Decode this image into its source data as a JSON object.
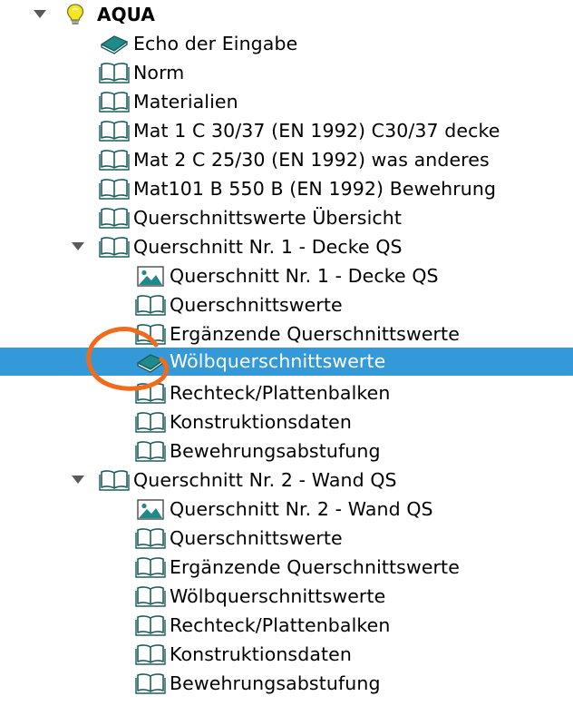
{
  "tree": {
    "root": {
      "label": "AQUA",
      "icon": "lightbulb-icon",
      "expanded": true
    },
    "items": [
      {
        "label": "Echo der Eingabe",
        "icon": "book-closed-icon"
      },
      {
        "label": "Norm",
        "icon": "book-open-icon"
      },
      {
        "label": "Materialien",
        "icon": "book-open-icon"
      },
      {
        "label": "Mat 1 C 30/37 (EN 1992) C30/37 decke",
        "icon": "book-open-icon"
      },
      {
        "label": "Mat 2 C 25/30 (EN 1992) was anderes",
        "icon": "book-open-icon"
      },
      {
        "label": "Mat101 B 550 B (EN 1992) Bewehrung",
        "icon": "book-open-icon"
      },
      {
        "label": "Querschnittswerte Übersicht",
        "icon": "book-open-icon"
      },
      {
        "label": "Querschnitt Nr. 1 - Decke QS",
        "icon": "book-open-icon",
        "expanded": true,
        "children": [
          {
            "label": "Querschnitt Nr. 1 - Decke QS",
            "icon": "image-icon"
          },
          {
            "label": "Querschnittswerte",
            "icon": "book-open-icon"
          },
          {
            "label": "Ergänzende Querschnittswerte",
            "icon": "book-open-icon"
          },
          {
            "label": "Wölbquerschnittswerte",
            "icon": "book-closed-icon",
            "selected": true
          },
          {
            "label": "Rechteck/Plattenbalken",
            "icon": "book-open-icon"
          },
          {
            "label": "Konstruktionsdaten",
            "icon": "book-open-icon"
          },
          {
            "label": "Bewehrungsabstufung",
            "icon": "book-open-icon"
          }
        ]
      },
      {
        "label": "Querschnitt Nr. 2 - Wand QS",
        "icon": "book-open-icon",
        "expanded": true,
        "children": [
          {
            "label": "Querschnitt Nr. 2 - Wand QS",
            "icon": "image-icon"
          },
          {
            "label": "Querschnittswerte",
            "icon": "book-open-icon"
          },
          {
            "label": "Ergänzende Querschnittswerte",
            "icon": "book-open-icon"
          },
          {
            "label": "Wölbquerschnittswerte",
            "icon": "book-open-icon"
          },
          {
            "label": "Rechteck/Plattenbalken",
            "icon": "book-open-icon"
          },
          {
            "label": "Konstruktionsdaten",
            "icon": "book-open-icon"
          },
          {
            "label": "Bewehrungsabstufung",
            "icon": "book-open-icon"
          }
        ]
      }
    ]
  },
  "colors": {
    "selection": "#3399d9",
    "selected_text": "#ffffff",
    "book_stroke": "#1d5e5e",
    "book_fill": "#1f8a8a",
    "annotation": "#f26a1b",
    "lightbulb": "#f5e625",
    "expander": "#5a5a5a"
  }
}
